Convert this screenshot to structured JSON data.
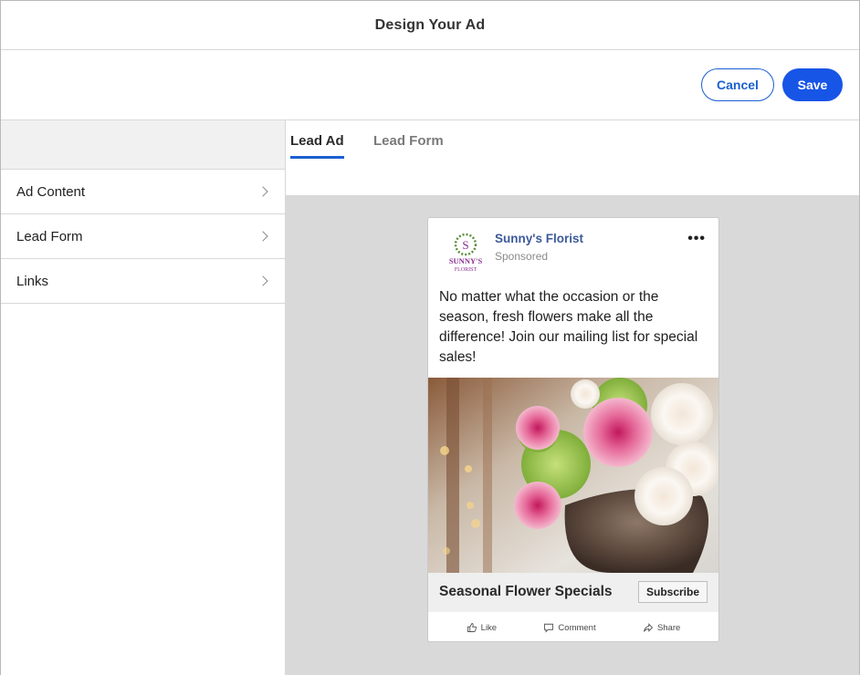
{
  "header": {
    "title": "Design Your Ad"
  },
  "actions": {
    "cancel_label": "Cancel",
    "save_label": "Save"
  },
  "sidebar": {
    "items": [
      {
        "label": "Ad Content"
      },
      {
        "label": "Lead Form"
      },
      {
        "label": "Links"
      }
    ]
  },
  "tabs": [
    {
      "label": "Lead Ad",
      "active": true
    },
    {
      "label": "Lead Form",
      "active": false
    }
  ],
  "ad": {
    "page_name": "Sunny's Florist",
    "sponsored": "Sponsored",
    "logo_text_line1": "SUNNY'S",
    "logo_text_line2": "FLORIST",
    "logo_monogram": "S",
    "body": "No matter what the occasion or the season, fresh flowers make all the difference! Join our mailing list for special sales!",
    "headline": "Seasonal Flower Specials",
    "cta_label": "Subscribe",
    "reactions": [
      {
        "label": "Like",
        "icon": "thumbs-up-icon"
      },
      {
        "label": "Comment",
        "icon": "comment-icon"
      },
      {
        "label": "Share",
        "icon": "share-icon"
      }
    ]
  },
  "colors": {
    "accent": "#1755e6",
    "page_name": "#3b5a9a",
    "preview_bg": "#d9d9d9",
    "logo_purple": "#8a2d8f"
  }
}
